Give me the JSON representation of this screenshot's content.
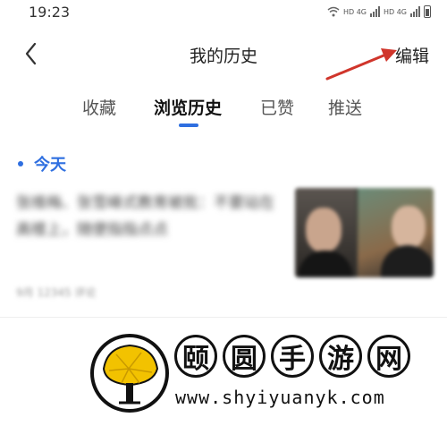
{
  "status_bar": {
    "time": "19:23",
    "network_1": "HD 4G",
    "network_2": "HD 4G",
    "icons": [
      "wifi-icon",
      "signal-icon",
      "signal-icon",
      "battery-icon"
    ]
  },
  "nav": {
    "back_icon": "chevron-left-icon",
    "title": "我的历史",
    "edit_label": "编辑"
  },
  "tabs": [
    {
      "label": "收藏",
      "active": false
    },
    {
      "label": "浏览历史",
      "active": true
    },
    {
      "label": "已赞",
      "active": false
    },
    {
      "label": "推送",
      "active": false
    }
  ],
  "history": {
    "section_label": "今天",
    "items": [
      {
        "title": "张维梅、张雪峰式教育被批：不要站在高楼上，随便指指点点",
        "meta": "9月 12345 评论",
        "thumbnail": "video-thumbnail"
      }
    ]
  },
  "watermark": {
    "chars": [
      "颐",
      "圆",
      "手",
      "游",
      "网"
    ],
    "url": "www.shyiyuanyk.com"
  },
  "colors": {
    "accent": "#2f6fe0",
    "annotation_arrow": "#d0352b",
    "watermark_gold": "#f2c200"
  }
}
